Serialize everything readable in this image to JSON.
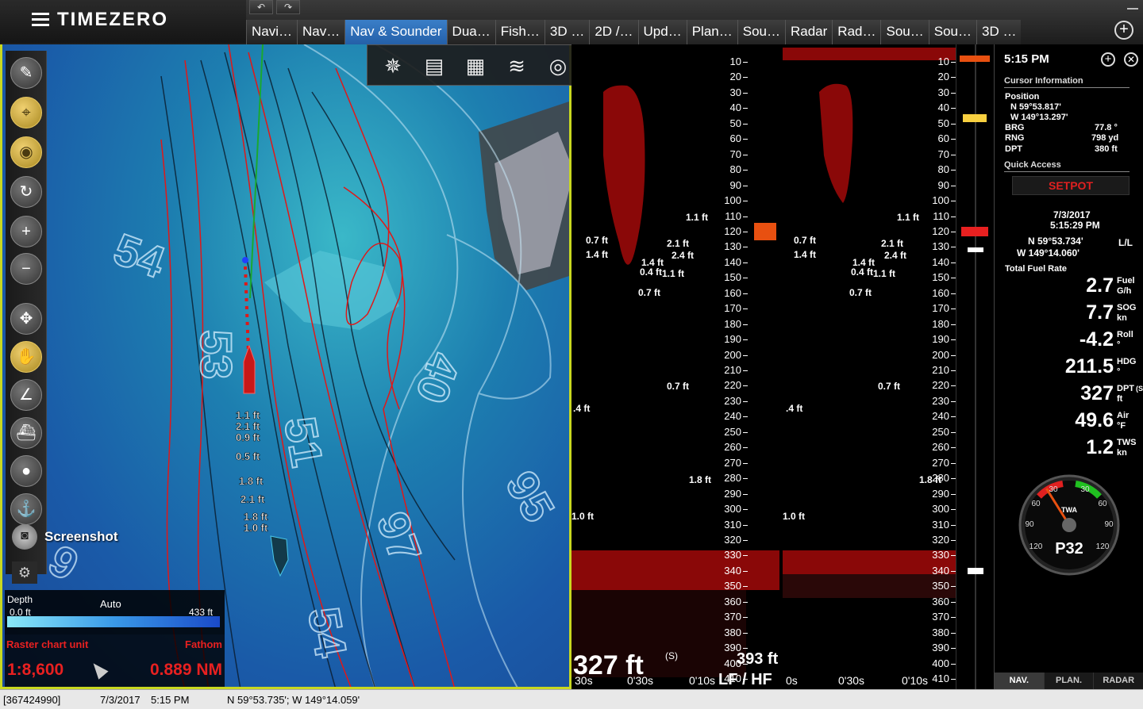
{
  "app": {
    "title": "TIMEZERO",
    "undo_icon": "undo-icon",
    "redo_icon": "redo-icon"
  },
  "tabs": [
    {
      "label": "Navi…"
    },
    {
      "label": "Nav…"
    },
    {
      "label": "Nav & Sounder",
      "active": true
    },
    {
      "label": "Dua…"
    },
    {
      "label": "Fish…"
    },
    {
      "label": "3D …"
    },
    {
      "label": "2D /…"
    },
    {
      "label": "Upd…"
    },
    {
      "label": "Plan…"
    },
    {
      "label": "Sou…"
    },
    {
      "label": "Radar"
    },
    {
      "label": "Rad…"
    },
    {
      "label": "Sou…"
    },
    {
      "label": "Sou…"
    },
    {
      "label": "3D …"
    }
  ],
  "chart": {
    "contour_labels": [
      "54",
      "53",
      "51",
      "40",
      "54",
      "97",
      "95",
      "9"
    ],
    "track_labels": [
      "1.1 ft",
      "2.1 ft",
      "0.9 ft",
      "0.5 ft",
      "1.8 ft",
      "2.1 ft",
      "1.8 ft",
      "1.0 ft"
    ],
    "screenshot_label": "Screenshot",
    "depth": {
      "title": "Depth",
      "mode": "Auto",
      "min": "0.0 ft",
      "max": "433 ft"
    },
    "raster": {
      "label": "Raster chart unit",
      "unit": "Fathom"
    },
    "scale": "1:8,600",
    "range": "0.889 NM"
  },
  "sounder": {
    "depth_ticks": [
      "10",
      "20",
      "30",
      "40",
      "50",
      "60",
      "70",
      "80",
      "90",
      "100",
      "110",
      "120",
      "130",
      "140",
      "150",
      "160",
      "170",
      "180",
      "190",
      "200",
      "210",
      "220",
      "230",
      "240",
      "250",
      "260",
      "270",
      "280",
      "290",
      "300",
      "310",
      "320",
      "330",
      "340",
      "350",
      "360",
      "370",
      "380",
      "390",
      "400",
      "410"
    ],
    "fish_labels_lf": [
      "1.1 ft",
      "0.7 ft",
      "1.4 ft",
      "2.1 ft",
      "2.4 ft",
      "1.4 ft",
      "0.4 ft",
      "1.1 ft",
      "0.7 ft",
      "0.7 ft",
      ".4 ft",
      "1.8 ft",
      "1.0 ft"
    ],
    "fish_labels_hf": [
      "1.1 ft",
      "0.7 ft",
      "1.4 ft",
      "2.1 ft",
      "2.4 ft",
      "1.4 ft",
      "0.4 ft",
      "1.1 ft",
      "0.7 ft",
      "0.7 ft",
      ".4 ft",
      "1.8 ft",
      "1.0 ft"
    ],
    "current_depth": "327 ft",
    "current_depth_source": "(S)",
    "hf_depth": "393 ft",
    "lf_hf_label": "LF / HF",
    "time_labels_lf": [
      "30s",
      "0'30s",
      "0'10s"
    ],
    "time_labels_hf": [
      "0s",
      "0'30s",
      "0'10s"
    ]
  },
  "instruments": {
    "time": "5:15 PM",
    "cursor_section": "Cursor Information",
    "position_label": "Position",
    "cursor_lat": "N 59°53.817'",
    "cursor_lon": "W 149°13.297'",
    "brg_label": "BRG",
    "brg_value": "77.8 °",
    "rng_label": "RNG",
    "rng_value": "798 yd",
    "dpt_label": "DPT",
    "dpt_value": "380 ft",
    "quick_access_section": "Quick Access",
    "setpot": "SETPOT",
    "date": "7/3/2017",
    "timestamp": "5:15:29 PM",
    "boat_lat": "N 59°53.734'",
    "ll_label": "L/L",
    "boat_lon": "W 149°14.060'",
    "fuel_section": "Total Fuel Rate",
    "gauges": [
      {
        "value": "2.7",
        "label": "Fuel",
        "unit": "G/h"
      },
      {
        "value": "7.7",
        "label": "SOG",
        "unit": "kn"
      },
      {
        "value": "-4.2",
        "label": "Roll",
        "unit": "°"
      },
      {
        "value": "211.5",
        "label": "HDG",
        "unit": "°"
      },
      {
        "value": "327",
        "label": "DPT",
        "unit": "ft",
        "source": "(S)"
      },
      {
        "value": "49.6",
        "label": "Air",
        "unit": "°F"
      },
      {
        "value": "1.2",
        "label": "TWS",
        "unit": "kn"
      }
    ],
    "wind": {
      "label": "TWA",
      "value": "P32",
      "ticks": [
        "30",
        "60",
        "90",
        "120",
        "30",
        "60",
        "90",
        "120"
      ],
      "angle": -32
    },
    "bottom_tabs": [
      "NAV.",
      "PLAN.",
      "RADAR"
    ]
  },
  "status": {
    "id": "[367424990]",
    "date": "7/3/2017",
    "time": "5:15 PM",
    "position": "N 59°53.735'; W 149°14.059'"
  },
  "colors": {
    "accent_tab": "#2c6fb8",
    "chart_border": "#c8d820",
    "alert_red": "#e02020"
  }
}
